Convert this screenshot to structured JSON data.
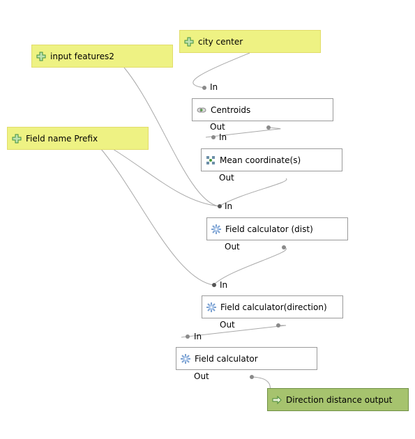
{
  "inputs": [
    {
      "label": "city center",
      "icon": "plus-icon"
    },
    {
      "label": "input features2",
      "icon": "plus-icon"
    },
    {
      "label": "Field name Prefix",
      "icon": "plus-icon"
    }
  ],
  "algorithms": [
    {
      "label": "Centroids",
      "icon": "centroids-icon",
      "in": "In",
      "out": "Out"
    },
    {
      "label": "Mean coordinate(s)",
      "icon": "mean-coordinates-icon",
      "in": "In",
      "out": "Out"
    },
    {
      "label": "Field calculator (dist)",
      "icon": "gear-icon",
      "in": "In",
      "out": "Out"
    },
    {
      "label": "Field calculator(direction)",
      "icon": "gear-icon",
      "in": "In",
      "out": "Out"
    },
    {
      "label": "Field calculator",
      "icon": "gear-icon",
      "in": "In",
      "out": "Out"
    }
  ],
  "output": {
    "label": "Direction distance output",
    "icon": "arrow-right-icon"
  },
  "colors": {
    "input_bg": "#eef283",
    "output_bg": "#a6c36e",
    "wire": "#a0a0a0",
    "port": "#888888"
  }
}
